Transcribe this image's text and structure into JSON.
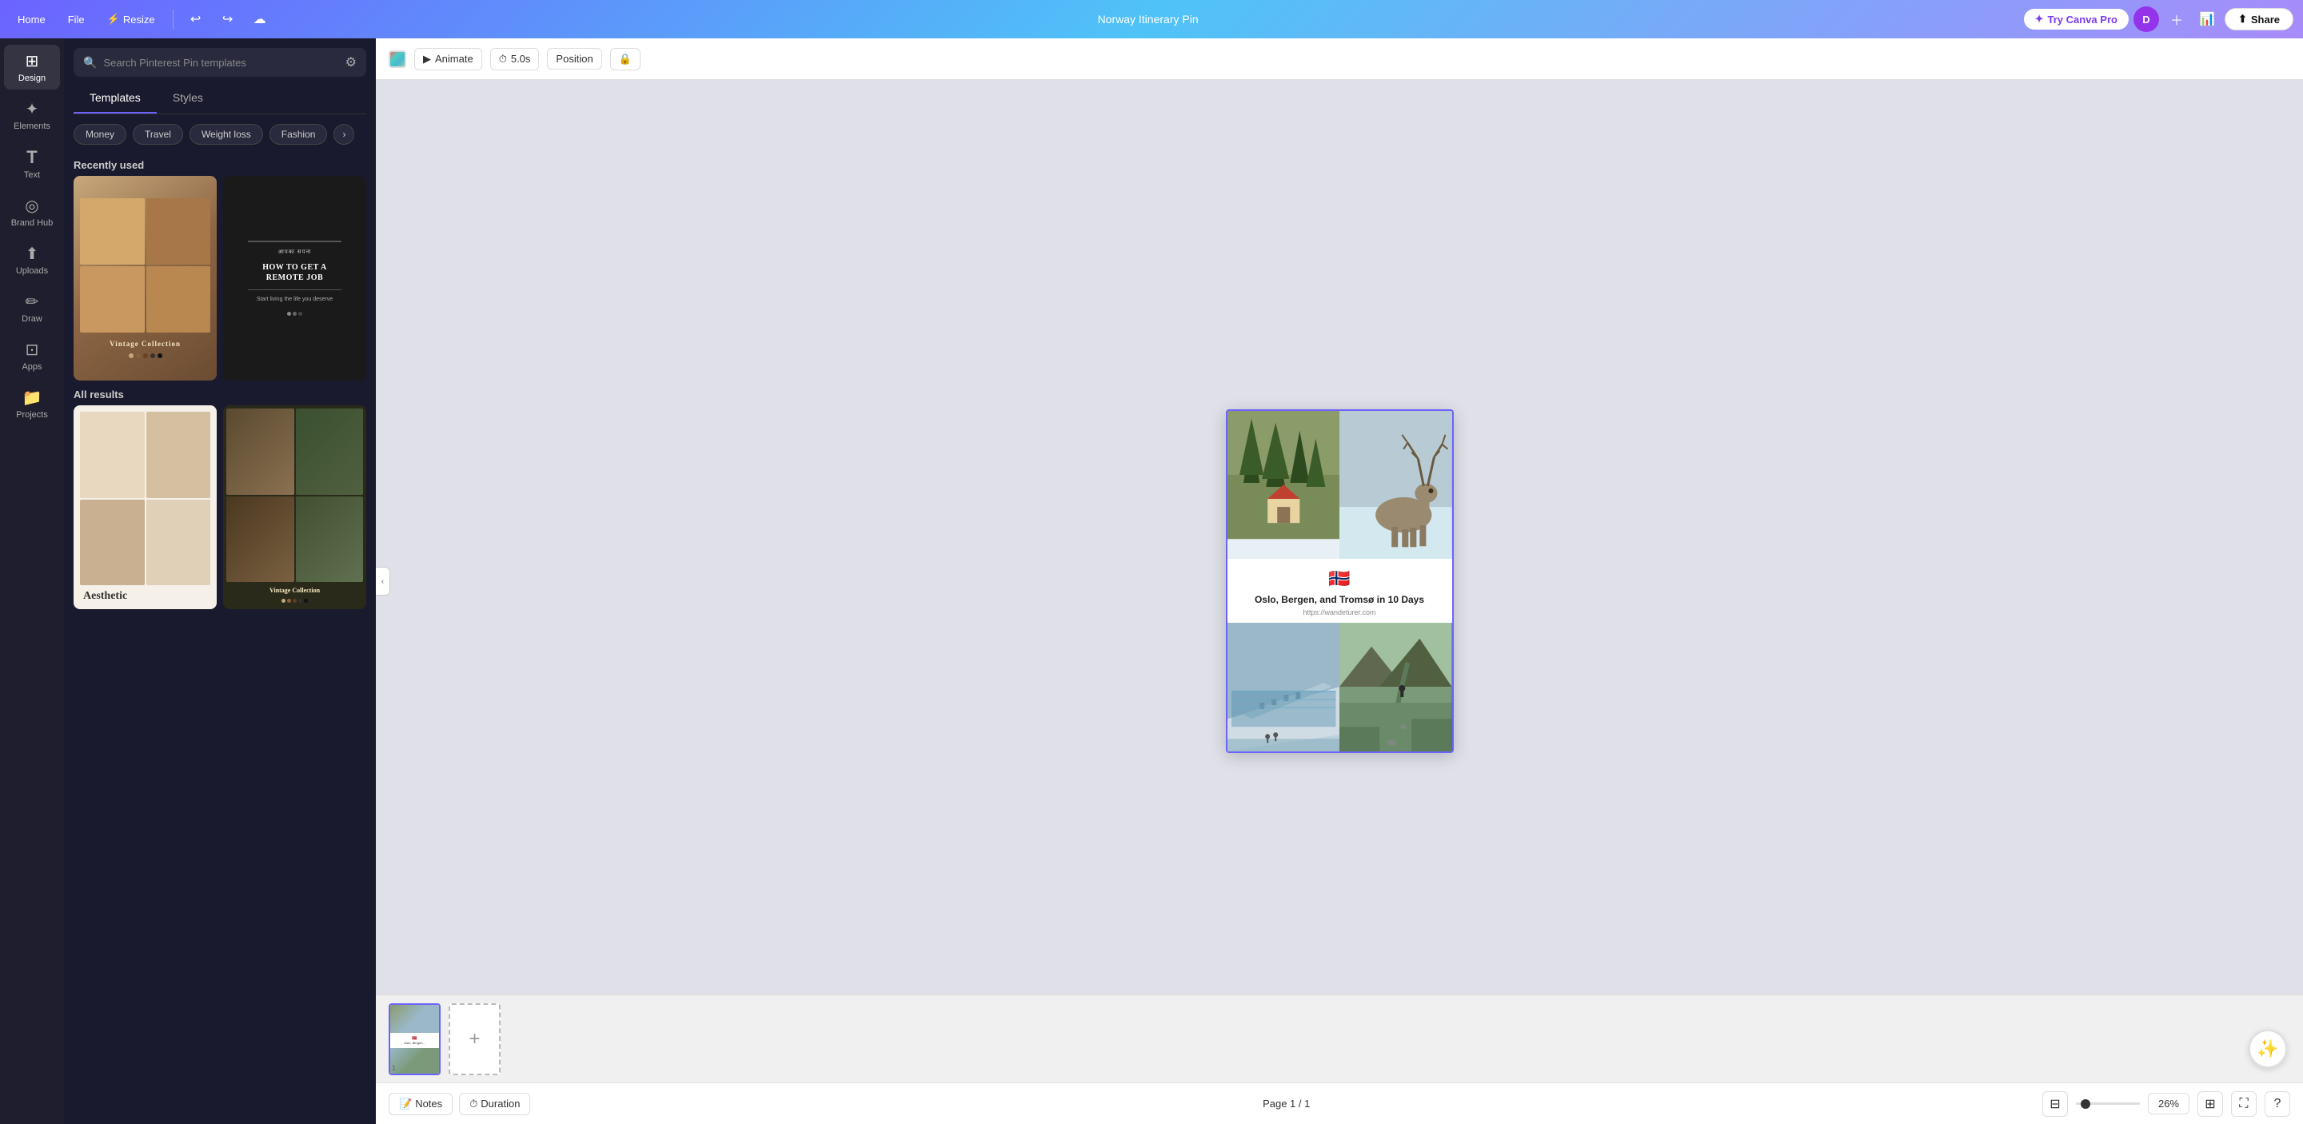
{
  "topbar": {
    "home_label": "Home",
    "file_label": "File",
    "resize_label": "Resize",
    "title": "Norway Itinerary Pin",
    "try_canva_label": "Try Canva Pro",
    "user_initial": "D",
    "share_label": "Share",
    "undo_icon": "↩",
    "redo_icon": "↪",
    "cloud_icon": "☁"
  },
  "sidebar": {
    "items": [
      {
        "id": "design",
        "label": "Design",
        "icon": "⊞",
        "active": true
      },
      {
        "id": "elements",
        "label": "Elements",
        "icon": "✦"
      },
      {
        "id": "text",
        "label": "Text",
        "icon": "T"
      },
      {
        "id": "brand-hub",
        "label": "Brand Hub",
        "icon": "◎"
      },
      {
        "id": "uploads",
        "label": "Uploads",
        "icon": "⬆"
      },
      {
        "id": "draw",
        "label": "Draw",
        "icon": "✏"
      },
      {
        "id": "apps",
        "label": "Apps",
        "icon": "⊡"
      },
      {
        "id": "projects",
        "label": "Projects",
        "icon": "📁"
      }
    ]
  },
  "panel": {
    "search_placeholder": "Search Pinterest Pin templates",
    "tabs": [
      {
        "id": "templates",
        "label": "Templates",
        "active": true
      },
      {
        "id": "styles",
        "label": "Styles"
      }
    ],
    "filter_chips": [
      {
        "id": "money",
        "label": "Money"
      },
      {
        "id": "travel",
        "label": "Travel"
      },
      {
        "id": "weight-loss",
        "label": "Weight loss"
      },
      {
        "id": "fashion",
        "label": "Fashion"
      }
    ],
    "recently_used_label": "Recently used",
    "all_results_label": "All results",
    "templates": [
      {
        "id": "vintage-1",
        "type": "vintage",
        "title": "Vintage Collection"
      },
      {
        "id": "remote-job",
        "type": "dark",
        "title": "HOW TO GET A REMOTE JOB"
      },
      {
        "id": "aesthetic",
        "type": "cream",
        "title": "Aesthetic"
      },
      {
        "id": "vintage-2",
        "type": "collage",
        "title": "Vintage Collection"
      }
    ]
  },
  "toolbar": {
    "animate_label": "Animate",
    "duration_label": "5.0s",
    "position_label": "Position",
    "lock_icon": "🔒"
  },
  "design": {
    "flag_emoji": "🇳🇴",
    "title": "Oslo, Bergen, and Tromsø in 10 Days",
    "url": "https://wandeturer.com"
  },
  "bottom_bar": {
    "notes_label": "Notes",
    "duration_label": "Duration",
    "page_info": "Page 1 / 1",
    "zoom_level": "26%",
    "hide_panels_icon": "⊟"
  },
  "thumbnail": {
    "page_num": "1"
  }
}
